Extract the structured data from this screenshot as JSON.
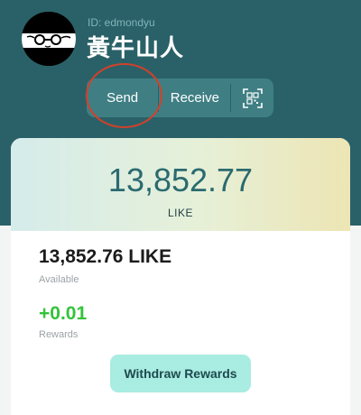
{
  "profile": {
    "id_text": "ID: edmondyu",
    "name": "黃牛山人"
  },
  "actions": {
    "send_label": "Send",
    "receive_label": "Receive",
    "qr_icon": "qr-scan-icon"
  },
  "balance": {
    "total": "13,852.77",
    "unit": "LIKE",
    "available_amount": "13,852.76 LIKE",
    "available_label": "Available",
    "rewards_amount": "+0.01",
    "rewards_label": "Rewards",
    "withdraw_label": "Withdraw Rewards"
  },
  "colors": {
    "header_bg": "#2a6168",
    "action_bar_bg": "#3f7f84",
    "accent_teal": "#2b6a70",
    "rewards_green": "#33c33b",
    "withdraw_bg": "#a9ece1",
    "highlight_ring": "#d2412a"
  }
}
